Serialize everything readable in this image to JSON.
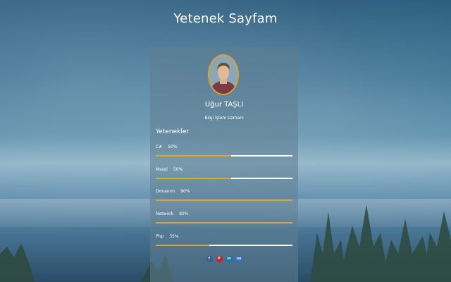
{
  "header": {
    "title": "Yetenek Sayfam"
  },
  "profile": {
    "name": "Uğur TAŞLI",
    "role": "Bilgi İşlem Uzmanı"
  },
  "skills_section": {
    "title": "Yetenekler",
    "items": [
      {
        "label": "C#",
        "percent_label": "50%",
        "level": 0.55
      },
      {
        "label": "Mssql",
        "percent_label": "50%",
        "level": 0.55
      },
      {
        "label": "Donanım",
        "percent_label": "90%",
        "level": 1.0
      },
      {
        "label": "Network",
        "percent_label": "90%",
        "level": 1.0
      },
      {
        "label": "Php",
        "percent_label": "35%",
        "level": 0.39
      }
    ]
  },
  "socials": [
    {
      "icon": "facebook-icon",
      "glyph": "f",
      "color": "#3b5998"
    },
    {
      "icon": "pinterest-icon",
      "glyph": "P",
      "color": "#cb2027"
    },
    {
      "icon": "linkedin-icon",
      "glyph": "in",
      "color": "#0e76a8"
    },
    {
      "icon": "delicious-icon",
      "glyph": "oo",
      "color": "#2a6fd6"
    }
  ],
  "colors": {
    "accent": "#e0a52e",
    "track": "#ffffff"
  }
}
